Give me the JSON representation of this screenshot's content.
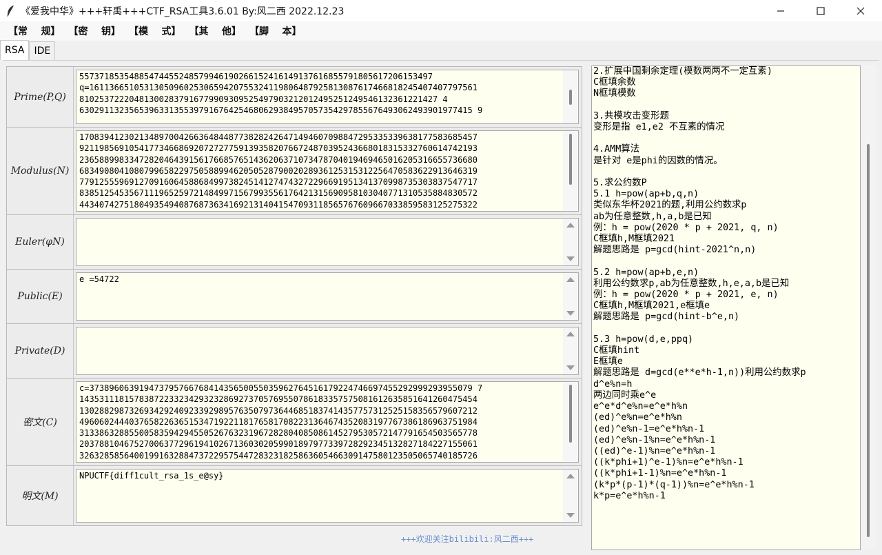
{
  "window": {
    "title": "《爱我中华》+++轩禹+++CTF_RSA工具3.6.01   By:风二西 2022.12.23",
    "icon": "feather-icon",
    "controls": [
      "minimize-icon",
      "maximize-icon",
      "close-icon"
    ]
  },
  "menu": [
    "【常    规】",
    "【密    钥】",
    "【模    式】",
    "【其    他】",
    "【脚    本】"
  ],
  "tabs": [
    "RSA",
    "IDE"
  ],
  "rows": {
    "prime": {
      "label": "Prime(P,Q)",
      "text": "55737185354885474455248579946190266152416149137616855791805617206153497\nq=161136651053130509602530659420755324119806487925813087617466818245407407797561\n810253722204813002837916779909309525497903212012495251249546132361221427 4\n6302911323565396331355397916764254680629384957057354297855676493062493901977415 9\n"
    },
    "modulus": {
      "label": "Modulus(N)",
      "text": "17083941230213489700426636484487738282426471494607098847295335339638177583685457\n92119856910541773466869207272775913935820766724870395243668018315332760614742193\n23658899833472820464391561766857651436206371073478704019469465016205316655736680\n68349080410807996582297505889946205052879002028936125315312256470583622913646319\n77912555969127091606458868499738245141274743272296691951341370998735303837547717\n83851254535671119652597214849971567993556176421315690958103040771310535884830572\n44340742751804935494087687363416921314041547093118565767609667033859583125275322"
    },
    "euler": {
      "label": "Euler(φN)",
      "text": ""
    },
    "public": {
      "label": "Public(E)",
      "text": "e =54722"
    },
    "private": {
      "label": "Private(D)",
      "text": ""
    },
    "cipher": {
      "label": "密文(C)",
      "text": "c=37389606391947379576676841435650055035962764516179224746697455292999293955079 7\n14353111815783872233234293232869273705769550786183357575081612635851641260475454\n13028829873269342924092339298957635079736446851837414357757312525158356579607212\n49606024440376582263651534719221181765817082231364674352083197767386186963751984\n31338632885500583594294550526763231967282804085086145279530572147791654503565778\n20378810467527006377296194102671360302059901897977339728292345132827184227155061\n32632858564001991632884737229575447283231825863605466309147580123505065740185726"
    },
    "plain": {
      "label": "明文(M)",
      "text": "NPUCTF{diff1cult_rsa_1s_e@sy}"
    }
  },
  "footer": "+++欢迎关注bilibili:风二西+++",
  "notes": "2.扩展中国剩余定理(模数两两不一定互素)\nC框填余数\nN框填模数\n\n3.共模攻击变形题\n变形是指 e1,e2 不互素的情况\n\n4.AMM算法\n是针对 e是phi的因数的情况。\n\n5.求公约数P\n5.1 h=pow(ap+b,q,n)\n类似东华杯2021的题,利用公约数求p\nab为任意整数,h,a,b是已知\n例：h = pow(2020 * p + 2021, q, n)\nC框填h,M框填2021\n解题思路是 p=gcd(hint-2021^n,n)\n\n5.2 h=pow(ap+b,e,n)\n利用公约数求p,ab为任意整数,h,e,a,b是已知\n例：h = pow(2020 * p + 2021, e, n)\nC框填h,M框填2021,e框填e\n解题思路是 p=gcd(hint-b^e,n)\n\n5.3 h=pow(d,e,ppq)\nC框填hint\nE框填e\n解题思路是 d=gcd(e**e*h-1,n))利用公约数求p\nd^e%n=h\n两边同时乘e^e\ne^e*d^e%n=e^e*h%n\n(ed)^e%n=e^e*h%n\n(ed)^e%n-1=e^e*h%n-1\n(ed)^e%n-1%n=e^e*h%n-1\n((ed)^e-1)%n=e^e*h%n-1\n((k*phi+1)^e-1)%n=e^e*h%n-1\n((k*phi+1-1)%n=e^e*h%n-1\n(k*p*(p-1)*(q-1))%n=e^e*h%n-1\nk*p=e^e*h%n-1"
}
